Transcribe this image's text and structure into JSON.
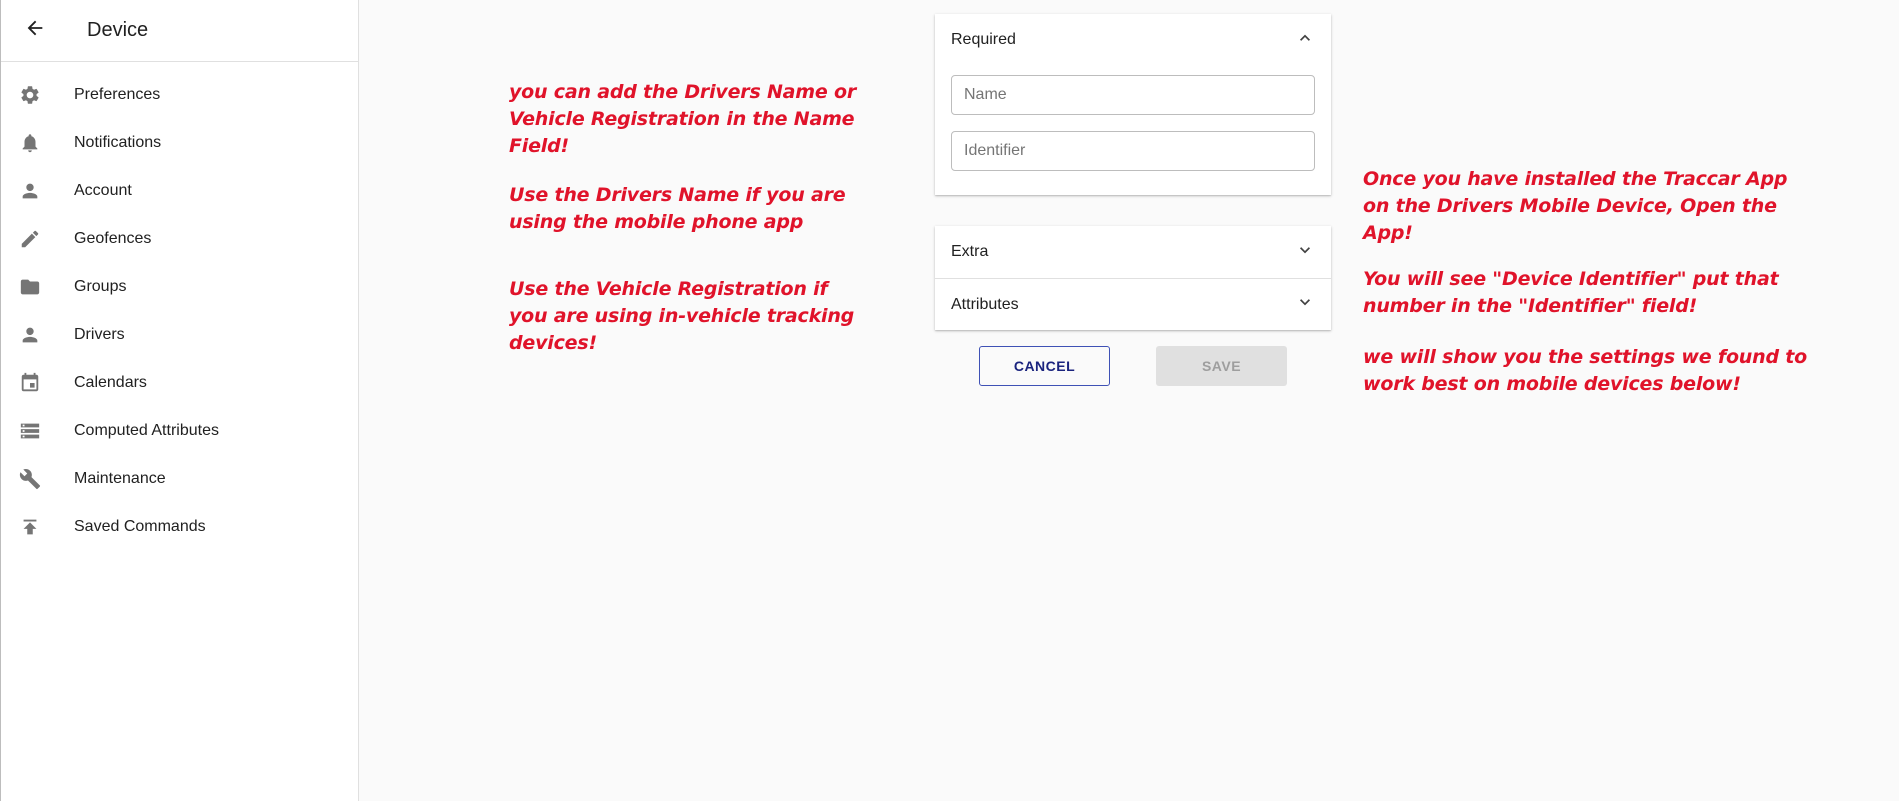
{
  "sidebar": {
    "title": "Device",
    "back_icon": "arrow-back-icon",
    "items": [
      {
        "label": "Preferences",
        "icon": "gear-icon"
      },
      {
        "label": "Notifications",
        "icon": "bell-icon"
      },
      {
        "label": "Account",
        "icon": "person-icon"
      },
      {
        "label": "Geofences",
        "icon": "pencil-icon"
      },
      {
        "label": "Groups",
        "icon": "folder-icon"
      },
      {
        "label": "Drivers",
        "icon": "person-icon"
      },
      {
        "label": "Calendars",
        "icon": "calendar-icon"
      },
      {
        "label": "Computed Attributes",
        "icon": "storage-icon"
      },
      {
        "label": "Maintenance",
        "icon": "wrench-icon"
      },
      {
        "label": "Saved Commands",
        "icon": "publish-icon"
      }
    ]
  },
  "form": {
    "required_label": "Required",
    "name_placeholder": "Name",
    "identifier_placeholder": "Identifier",
    "extra_label": "Extra",
    "attributes_label": "Attributes",
    "cancel_label": "CANCEL",
    "save_label": "SAVE"
  },
  "annotations": {
    "left_1": "you can add the Drivers Name or\nVehicle Registration in the Name\nField!",
    "left_2": "Use the Drivers Name if you are\nusing the mobile phone app",
    "left_3": "Use the Vehicle Registration if\nyou are using in-vehicle tracking\ndevices!",
    "right_1": "Once you have installed the Traccar App\non the Drivers Mobile Device,   Open the\nApp!",
    "right_2": "You will see \"Device Identifier\" put that\nnumber in the \"Identifier\" field!",
    "right_3": "we will show you the settings we found to\nwork best on mobile devices below!"
  },
  "colors": {
    "annotation": "#e0132a",
    "accent": "#3f51b5"
  }
}
